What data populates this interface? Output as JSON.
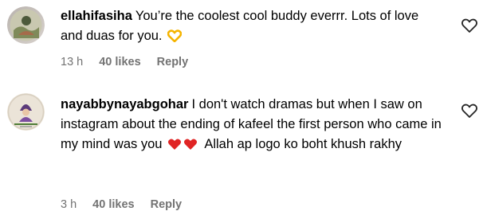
{
  "comments": [
    {
      "username": "ellahifasiha",
      "text": "You’re the coolest cool buddy everrr. Lots of love and duas for you.",
      "emoji_icon": "heart-hands-icon",
      "time": "13 h",
      "likes": "40 likes",
      "reply": "Reply"
    },
    {
      "username": "nayabbynayabgohar",
      "text_before": "I don't watch dramas but when I saw on instagram about the ending of kafeel the first person who came in my mind was you",
      "emoji_icons": [
        "red-heart-icon",
        "red-heart-icon"
      ],
      "text_after": "Allah ap logo ko boht khush rakhy",
      "time": "3 h",
      "likes": "40 likes",
      "reply": "Reply"
    }
  ],
  "colors": {
    "meta": "#737373",
    "heart": "#e02424",
    "hands": "#f5b400"
  }
}
